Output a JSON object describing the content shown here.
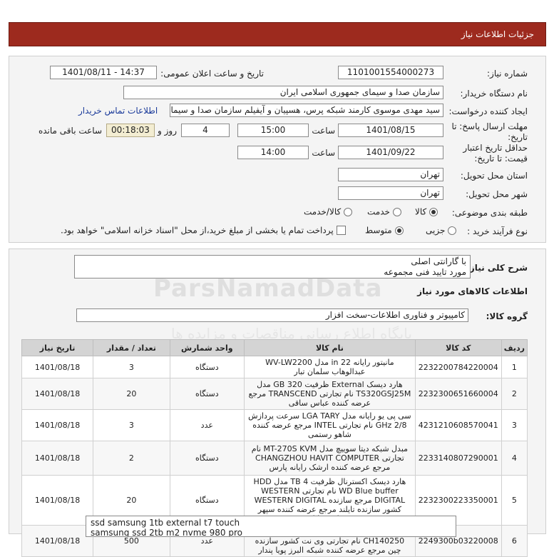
{
  "header": {
    "title": "جزئیات اطلاعات نیاز"
  },
  "form": {
    "need_number_label": "شماره نیاز:",
    "need_number": "1101001554000273",
    "announce_label": "تاریخ و ساعت اعلان عمومی:",
    "announce_value": "1401/08/11 - 14:37",
    "buyer_label": "نام دستگاه خریدار:",
    "buyer_value": "سازمان صدا و سیمای جمهوری اسلامی ایران",
    "creator_label": "ایجاد کننده درخواست:",
    "creator_value": "سید مهدی موسوی کارمند شبکه پرس، هسپیان و آیفیلم سازمان صدا و سیمای",
    "contact_link": "اطلاعات تماس خریدار",
    "deadline_label_1": "مهلت ارسال پاسخ: تا",
    "deadline_label_2": "تاریخ:",
    "deadline_date": "1401/08/15",
    "time_label": "ساعت",
    "deadline_time": "15:00",
    "days_value": "4",
    "days_label": "روز و",
    "remain_value": "00:18:03",
    "remain_label": "ساعت باقی مانده",
    "validity_label_1": "حداقل تاریخ اعتبار",
    "validity_label_2": "قیمت: تا تاریخ:",
    "validity_date": "1401/09/22",
    "validity_time_label": "ساعت",
    "validity_time": "14:00",
    "province_label": "استان محل تحویل:",
    "province_value": "تهران",
    "city_label": "شهر محل تحویل:",
    "city_value": "تهران",
    "category_label": "طبقه بندی موضوعی:",
    "category_options": [
      "کالا",
      "خدمت",
      "کالا/خدمت"
    ],
    "process_label": "نوع فرآیند خرید :",
    "process_options": [
      "جزیی",
      "متوسط"
    ],
    "treasury_text": "پرداخت تمام یا بخشی از مبلغ خرید،از محل \"اسناد خزانه اسلامی\" خواهد بود."
  },
  "description": {
    "label": "شرح کلی نیاز:",
    "line1": "با گارانتی اصلی",
    "line2": "مورد تایید فنی مجموعه"
  },
  "goods": {
    "section_title": "اطلاعات کالاهای مورد نیاز",
    "group_label": "گروه کالا:",
    "group_value": "کامپیوتر و فناوری اطلاعات-سخت افزار"
  },
  "table": {
    "headers": [
      "ردیف",
      "کد کالا",
      "نام کالا",
      "واحد شمارش",
      "تعداد / مقدار",
      "تاریخ نیاز"
    ],
    "rows": [
      {
        "idx": "1",
        "code": "2232200784220004",
        "name": "مانیتور رایانه 22 in مدل WV-LW2200 عبدالوهاب سلمان تبار",
        "unit": "دستگاه",
        "qty": "3",
        "date": "1401/08/18"
      },
      {
        "idx": "2",
        "code": "2232300651660004",
        "name": "هارد دیسک External ظرفیت 320 GB مدل TS320GSJ25M نام تجارتی TRANSCEND مرجع عرضه کننده عباس ساقی",
        "unit": "دستگاه",
        "qty": "20",
        "date": "1401/08/18"
      },
      {
        "idx": "3",
        "code": "4231210608570041",
        "name": "سی پی یو رایانه مدل LGA TARY سرعت پردازش 2/8 GHz نام تجارتی INTEL مرجع عرضه کننده شاهو رستمی",
        "unit": "عدد",
        "qty": "3",
        "date": "1401/08/18"
      },
      {
        "idx": "4",
        "code": "2233140807290001",
        "name": "مبدل شبکه دیتا سوییچ مدل MT-270S KVM نام تجارتی CHANGZHOU HAVIT COMPUTER مرجع عرضه کننده ارشک رایانه پارس",
        "unit": "دستگاه",
        "qty": "2",
        "date": "1401/08/18"
      },
      {
        "idx": "5",
        "code": "2232300223350001",
        "name": "هارد دیسک اکسترنال ظرفیت 4 TB مدل HDD WD Blue buffer نام تجارتی WESTERN DIGITAL مرجع سازنده WESTERN DIGITAL کشور سازنده تایلند مرجع عرضه کننده سپهر تجارت راتا",
        "unit": "دستگاه",
        "qty": "20",
        "date": "1401/08/18"
      },
      {
        "idx": "6",
        "code": "2249300b03220008",
        "name": "کابل HDMI 1.4V طول 25 m مدل V-CH140250 نام تجارتی وی نت کشور سازنده چین مرجع عرضه کننده شبکه البرز پویا پندار",
        "unit": "عدد",
        "qty": "500",
        "date": "1401/08/18"
      }
    ]
  },
  "notes": {
    "line1": "ssd samsung 1tb external t7 touch",
    "line2": "samsung ssd 2tb m2 nvme 980 pro"
  },
  "watermark": {
    "brand": "ParsNamadData",
    "sub": "پایگاه اطلاع رسانی مناقصات و مزایده ها",
    "phone": "۰۲۱-۸۸۳۴۹۶۷۰"
  }
}
